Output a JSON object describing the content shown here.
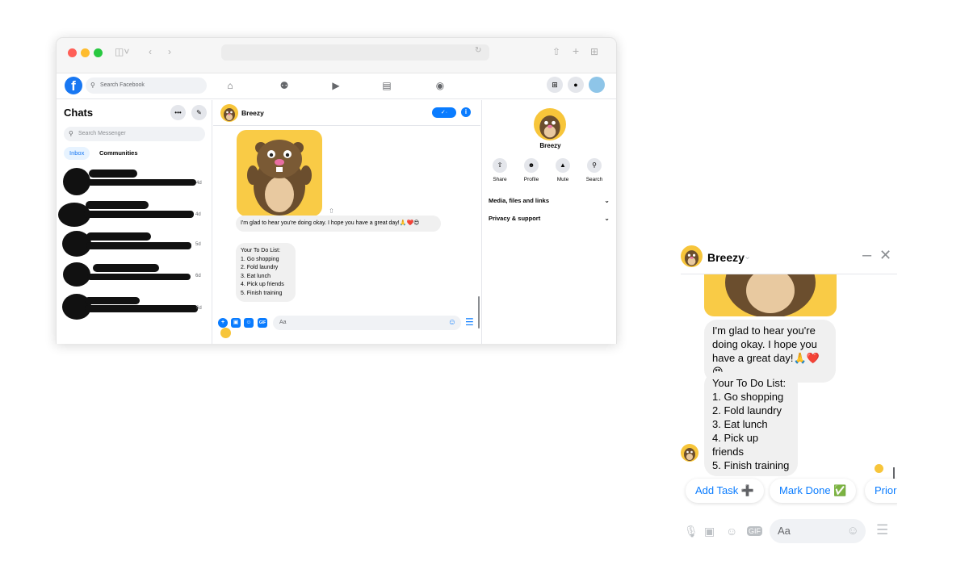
{
  "browser": {
    "traffic_lights": [
      "#ff5f57",
      "#febc2e",
      "#28c840"
    ]
  },
  "facebook": {
    "logo": "f",
    "search_placeholder": "Search Facebook",
    "nav_icons": [
      "home-icon",
      "friends-icon",
      "watch-icon",
      "marketplace-icon",
      "groups-icon"
    ],
    "accent": "#1877f2"
  },
  "chats": {
    "title": "Chats",
    "search_placeholder": "Search Messenger",
    "tabs": [
      "Inbox",
      "Communities"
    ],
    "items": [
      {
        "time": "4d"
      },
      {
        "time": "4d"
      },
      {
        "time": "5d"
      },
      {
        "time": "6d"
      },
      {
        "time": "6d"
      }
    ]
  },
  "conversation": {
    "name": "Breezy",
    "verified_label": "✓·",
    "message_1": "I'm glad to hear you're doing okay. I hope you have a great day!🙏❤️😍",
    "todo_lines": [
      "Your To Do List:",
      "1. Go shopping",
      "2. Fold laundry",
      "3. Eat lunch",
      "4. Pick up friends",
      "5. Finish training"
    ],
    "input_placeholder": "Aa"
  },
  "profile_panel": {
    "name": "Breezy",
    "actions": [
      "Share",
      "Profile",
      "Mute",
      "Search"
    ],
    "rows": [
      "Media, files and links",
      "Privacy & support"
    ]
  },
  "widget": {
    "name": "Breezy",
    "message_1": "I'm glad to hear you're doing okay. I hope you have a great day!🙏❤️😍",
    "todo_lines": [
      "Your To Do List:",
      "1. Go shopping",
      "2. Fold laundry",
      "3. Eat lunch",
      "4. Pick up friends",
      "5. Finish training"
    ],
    "quick_replies": [
      "Add Task ➕",
      "Mark Done ✅",
      "Priori"
    ],
    "input_placeholder": "Aa"
  }
}
